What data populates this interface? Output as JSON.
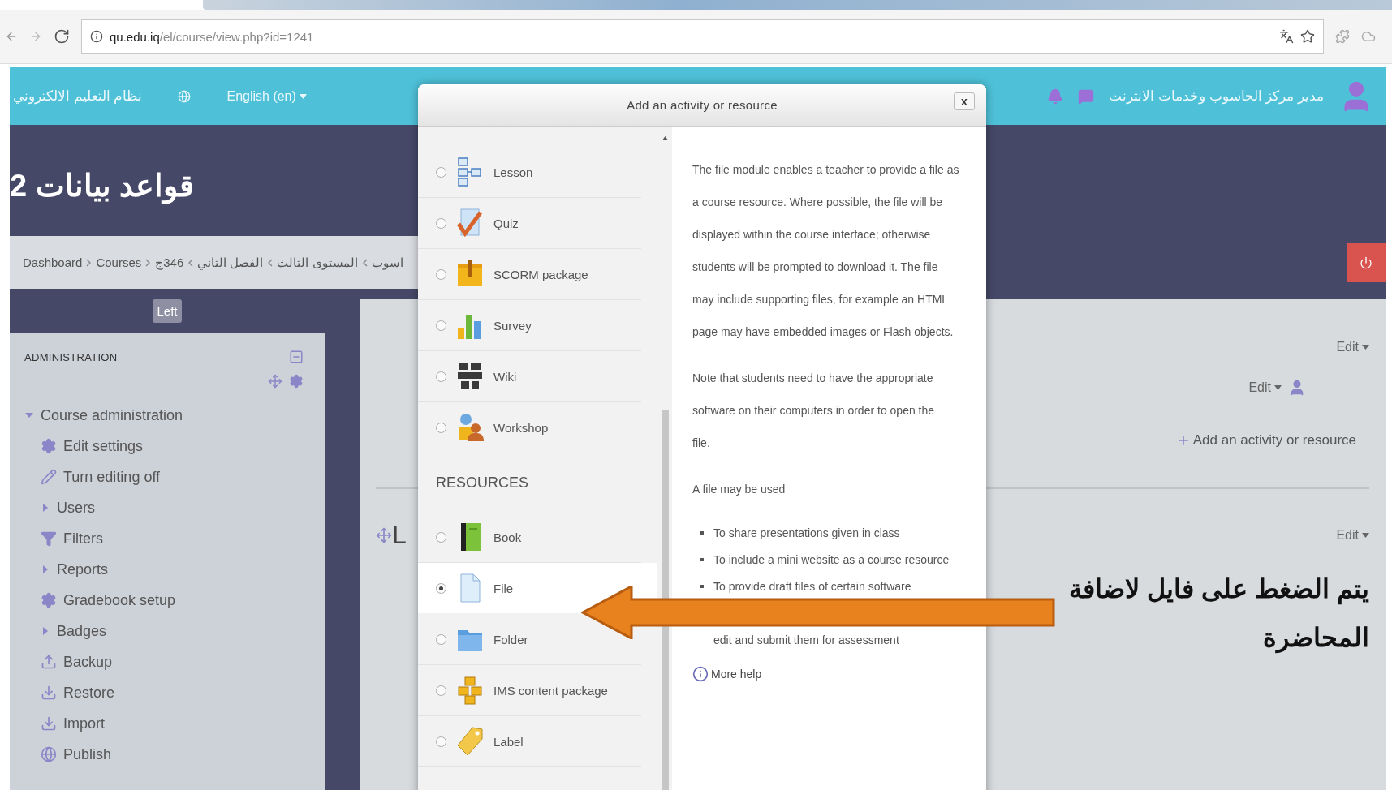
{
  "browser": {
    "url_host": "qu.edu.iq",
    "url_path": "/el/course/view.php?id=1241"
  },
  "navbar": {
    "site_name": "نظام التعليم الالكتروني",
    "language": "English (en)",
    "user_name": "مدير مركز الحاسوب وخدمات الانترنت"
  },
  "course": {
    "title": "قواعد بيانات 2"
  },
  "breadcrumb": [
    "Dashboard",
    "Courses"
  ],
  "breadcrumb_course_path": [
    "اسوب",
    "المستوى الثالث",
    "الفصل الثاني",
    "346ج"
  ],
  "left_toggle": "Left",
  "admin_block": {
    "title": "ADMINISTRATION",
    "tree": [
      {
        "label": "Course administration",
        "kind": "branch",
        "expanded": true,
        "children": [
          {
            "label": "Edit settings",
            "kind": "gear"
          },
          {
            "label": "Turn editing off",
            "kind": "pencil"
          },
          {
            "label": "Users",
            "kind": "branch",
            "expanded": false
          },
          {
            "label": "Filters",
            "kind": "filter"
          },
          {
            "label": "Reports",
            "kind": "branch",
            "expanded": false
          },
          {
            "label": "Gradebook setup",
            "kind": "gear"
          },
          {
            "label": "Badges",
            "kind": "branch",
            "expanded": false
          },
          {
            "label": "Backup",
            "kind": "upload"
          },
          {
            "label": "Restore",
            "kind": "download"
          },
          {
            "label": "Import",
            "kind": "download"
          },
          {
            "label": "Publish",
            "kind": "globe"
          }
        ]
      }
    ]
  },
  "main": {
    "section_1": {
      "edit": "Edit",
      "summary_edit": "Edit",
      "add_activity": "Add an activity or resource"
    },
    "section_2": {
      "title": "L",
      "edit": "Edit",
      "note": "يتم الضغط على فايل لاضافة المحاضرة"
    }
  },
  "modal": {
    "title": "Add an activity or resource",
    "close": "x",
    "groups": [
      {
        "items": [
          {
            "label": "Lesson",
            "kind": "lesson",
            "selected": false
          },
          {
            "label": "Quiz",
            "kind": "quiz",
            "selected": false
          },
          {
            "label": "SCORM package",
            "kind": "scorm",
            "selected": false
          },
          {
            "label": "Survey",
            "kind": "survey",
            "selected": false
          },
          {
            "label": "Wiki",
            "kind": "wiki",
            "selected": false
          },
          {
            "label": "Workshop",
            "kind": "workshop",
            "selected": false
          }
        ]
      },
      {
        "header": "RESOURCES",
        "items": [
          {
            "label": "Book",
            "kind": "book",
            "selected": false
          },
          {
            "label": "File",
            "kind": "file",
            "selected": true
          },
          {
            "label": "Folder",
            "kind": "folder",
            "selected": false
          },
          {
            "label": "IMS content package",
            "kind": "ims",
            "selected": false
          },
          {
            "label": "Label",
            "kind": "label",
            "selected": false
          }
        ]
      }
    ],
    "description": {
      "paragraphs": [
        "The file module enables a teacher to provide a file as a course resource. Where possible, the file will be displayed within the course interface; otherwise students will be prompted to download it. The file may include supporting files, for example an HTML page may have embedded images or Flash objects.",
        "Note that students need to have the appropriate software on their computers in order to open the file.",
        "A file may be used"
      ],
      "bullets": [
        "To share presentations given in class",
        "To include a mini website as a course resource",
        "To provide draft files of certain software"
      ],
      "bullet_continuation": "edit and submit them for assessment",
      "more_help": "More help"
    }
  }
}
